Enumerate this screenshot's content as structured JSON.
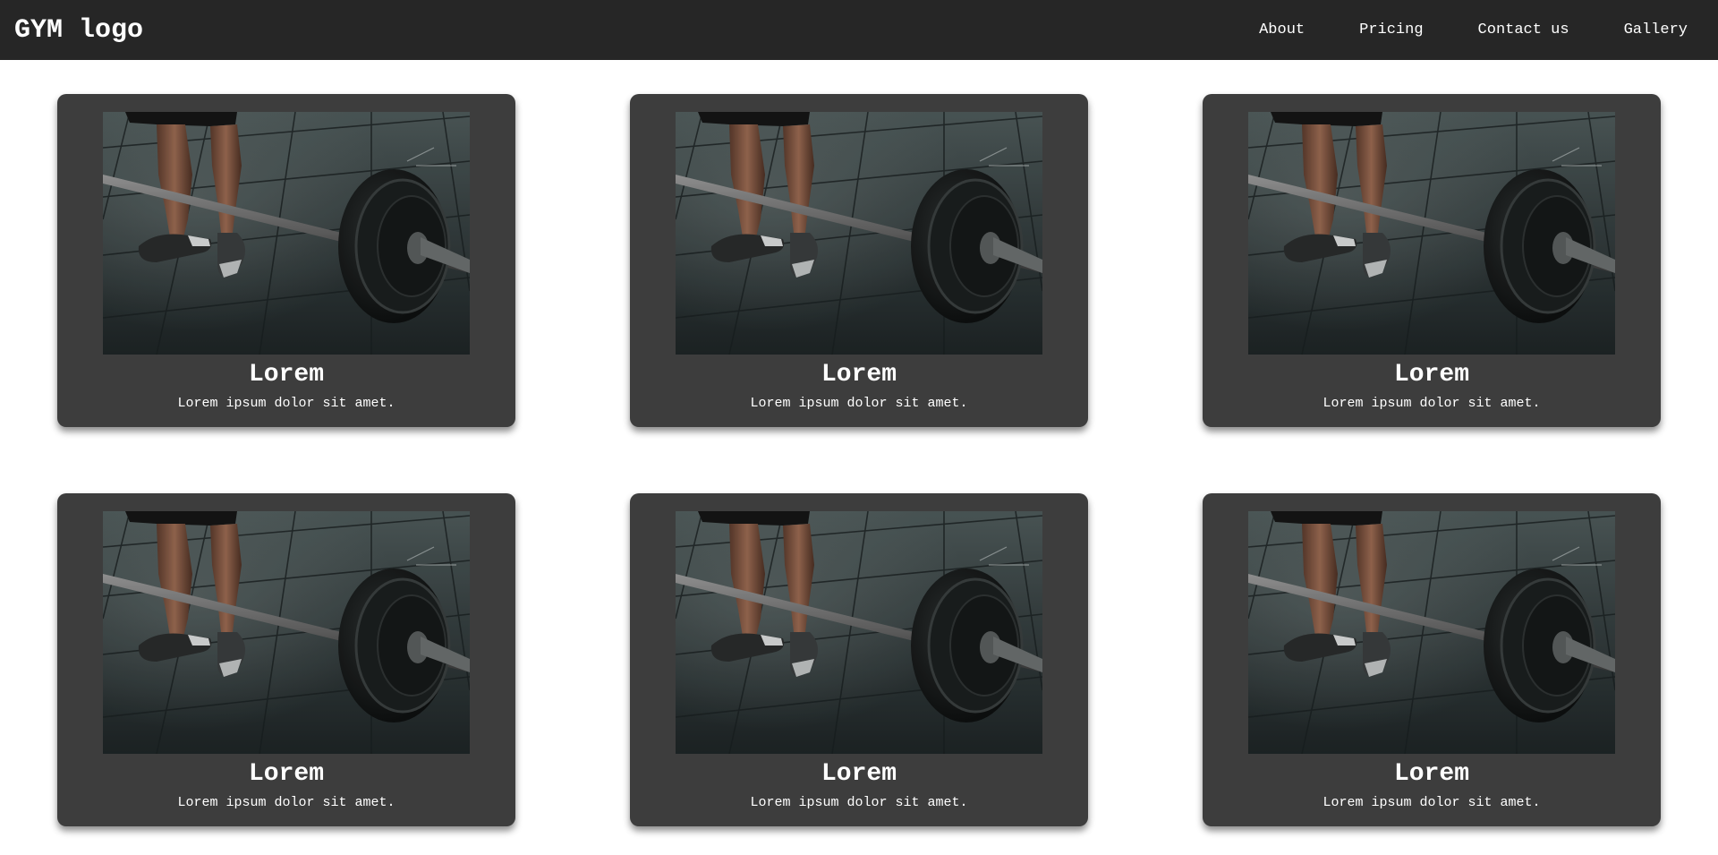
{
  "header": {
    "logo": "GYM logo",
    "nav": [
      "About",
      "Pricing",
      "Contact us",
      "Gallery"
    ]
  },
  "cards": [
    {
      "title": "Lorem",
      "text": "Lorem ipsum dolor sit amet.",
      "image": "barbell-deadlift-photo"
    },
    {
      "title": "Lorem",
      "text": "Lorem ipsum dolor sit amet.",
      "image": "barbell-deadlift-photo"
    },
    {
      "title": "Lorem",
      "text": "Lorem ipsum dolor sit amet.",
      "image": "barbell-deadlift-photo"
    },
    {
      "title": "Lorem",
      "text": "Lorem ipsum dolor sit amet.",
      "image": "barbell-deadlift-photo"
    },
    {
      "title": "Lorem",
      "text": "Lorem ipsum dolor sit amet.",
      "image": "barbell-deadlift-photo"
    },
    {
      "title": "Lorem",
      "text": "Lorem ipsum dolor sit amet.",
      "image": "barbell-deadlift-photo"
    }
  ],
  "colors": {
    "header_bg": "#262626",
    "card_bg": "#3d3d3d",
    "page_bg": "#ffffff",
    "text": "#ffffff"
  }
}
